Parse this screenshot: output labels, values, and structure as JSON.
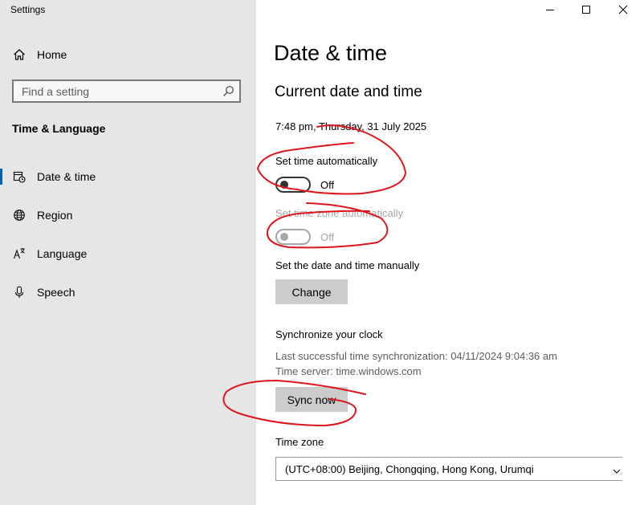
{
  "window": {
    "title": "Settings"
  },
  "sidebar": {
    "home_label": "Home",
    "search_placeholder": "Find a setting",
    "section_title": "Time & Language",
    "items": [
      {
        "label": "Date & time",
        "icon": "calendar-clock-icon",
        "active": true
      },
      {
        "label": "Region",
        "icon": "globe-icon",
        "active": false
      },
      {
        "label": "Language",
        "icon": "language-icon",
        "active": false
      },
      {
        "label": "Speech",
        "icon": "microphone-icon",
        "active": false
      }
    ]
  },
  "main": {
    "page_title": "Date & time",
    "subtitle": "Current date and time",
    "current_datetime": "7:48 pm, Thursday, 31 July 2025",
    "set_time_auto": {
      "label": "Set time automatically",
      "state": "Off"
    },
    "set_timezone_auto": {
      "label": "Set time zone automatically",
      "state": "Off"
    },
    "manual": {
      "label": "Set the date and time manually",
      "button": "Change"
    },
    "sync": {
      "heading": "Synchronize your clock",
      "last_sync": "Last successful time synchronization: 04/11/2024 9:04:36 am",
      "server": "Time server: time.windows.com",
      "button": "Sync now"
    },
    "timezone": {
      "label": "Time zone",
      "value": "(UTC+08:00) Beijing, Chongqing, Hong Kong, Urumqi"
    }
  },
  "colors": {
    "accent": "#0063b1",
    "annotation": "#e0141b",
    "sidebar_bg": "#e6e6e6",
    "button_bg": "#cccccc"
  }
}
